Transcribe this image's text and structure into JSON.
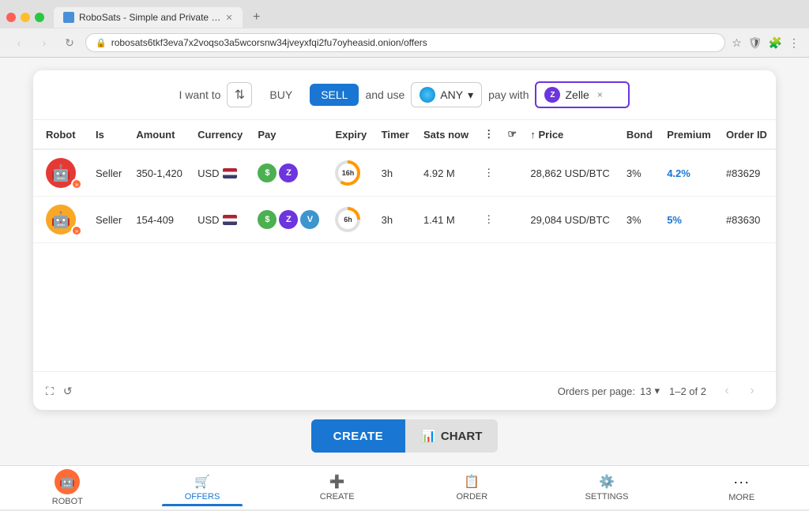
{
  "browser": {
    "tab_title": "RoboSats - Simple and Private …",
    "url": "robosats6tkf3eva7x2voqso3a5wcorsnw34jveyxfqi2fu7oyheasid.onion/offers",
    "new_tab_label": "+"
  },
  "filter": {
    "i_want_to": "I want to",
    "buy_label": "BUY",
    "sell_label": "SELL",
    "and_use": "and use",
    "currency_label": "ANY",
    "pay_with": "pay with",
    "payment_filter": "Zelle ×"
  },
  "table": {
    "headers": [
      "Robot",
      "Is",
      "Amount",
      "Currency",
      "Pay",
      "Expiry",
      "Timer",
      "Sats now",
      "",
      "",
      "↑ Price",
      "Bond",
      "Premium",
      "Order ID"
    ],
    "rows": [
      {
        "robot_emoji": "🤖",
        "robot_color": "#e53935",
        "robot_label": "robot-1",
        "is": "Seller",
        "amount": "350-1,420",
        "currency": "USD",
        "expiry": "16h",
        "timer_type": "16h",
        "timer": "3h",
        "sats_now": "4.92 M",
        "price": "28,862 USD/BTC",
        "bond": "3%",
        "premium": "4.2%",
        "premium_color": "#1976d2",
        "order_id": "#83629"
      },
      {
        "robot_emoji": "🤖",
        "robot_color": "#f9a825",
        "robot_label": "robot-2",
        "is": "Seller",
        "amount": "154-409",
        "currency": "USD",
        "expiry": "6h",
        "timer_type": "6h",
        "timer": "3h",
        "sats_now": "1.41 M",
        "price": "29,084 USD/BTC",
        "bond": "3%",
        "premium": "5%",
        "premium_color": "#1976d2",
        "order_id": "#83630"
      }
    ]
  },
  "footer": {
    "orders_per_page_label": "Orders per page:",
    "per_page_value": "13",
    "pagination_info": "1–2 of 2"
  },
  "actions": {
    "create_label": "CREATE",
    "chart_label": "CHART"
  },
  "bottom_nav": {
    "items": [
      {
        "label": "ROBOT",
        "icon": "⚙️"
      },
      {
        "label": "OFFERS",
        "icon": "🛒"
      },
      {
        "label": "CREATE",
        "icon": "+"
      },
      {
        "label": "ORDER",
        "icon": "📋"
      },
      {
        "label": "SETTINGS",
        "icon": "⚙️"
      },
      {
        "label": "MORE",
        "icon": "···"
      }
    ]
  }
}
